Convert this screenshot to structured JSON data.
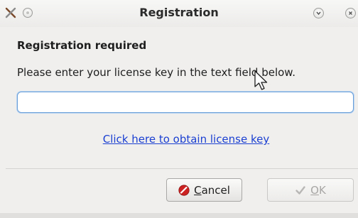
{
  "window": {
    "title": "Registration",
    "controls": [
      "menu-icon",
      "sticky-icon",
      "minimize-icon",
      "close-icon"
    ]
  },
  "content": {
    "heading": "Registration required",
    "instruction": "Please enter your license key in the text field below.",
    "license_input": {
      "value": "",
      "placeholder": ""
    },
    "link_text": "Click here to obtain license key"
  },
  "buttons": {
    "cancel": {
      "prefix": "",
      "accel": "C",
      "rest": "ancel",
      "icon": "cancel-icon",
      "enabled": true
    },
    "ok": {
      "prefix": "",
      "accel": "O",
      "rest": "K",
      "icon": "checkmark-icon",
      "enabled": false
    }
  },
  "colors": {
    "link": "#1a3fd1",
    "input_focus": "#6a9fd8",
    "cancel_icon": "#cc2222"
  }
}
